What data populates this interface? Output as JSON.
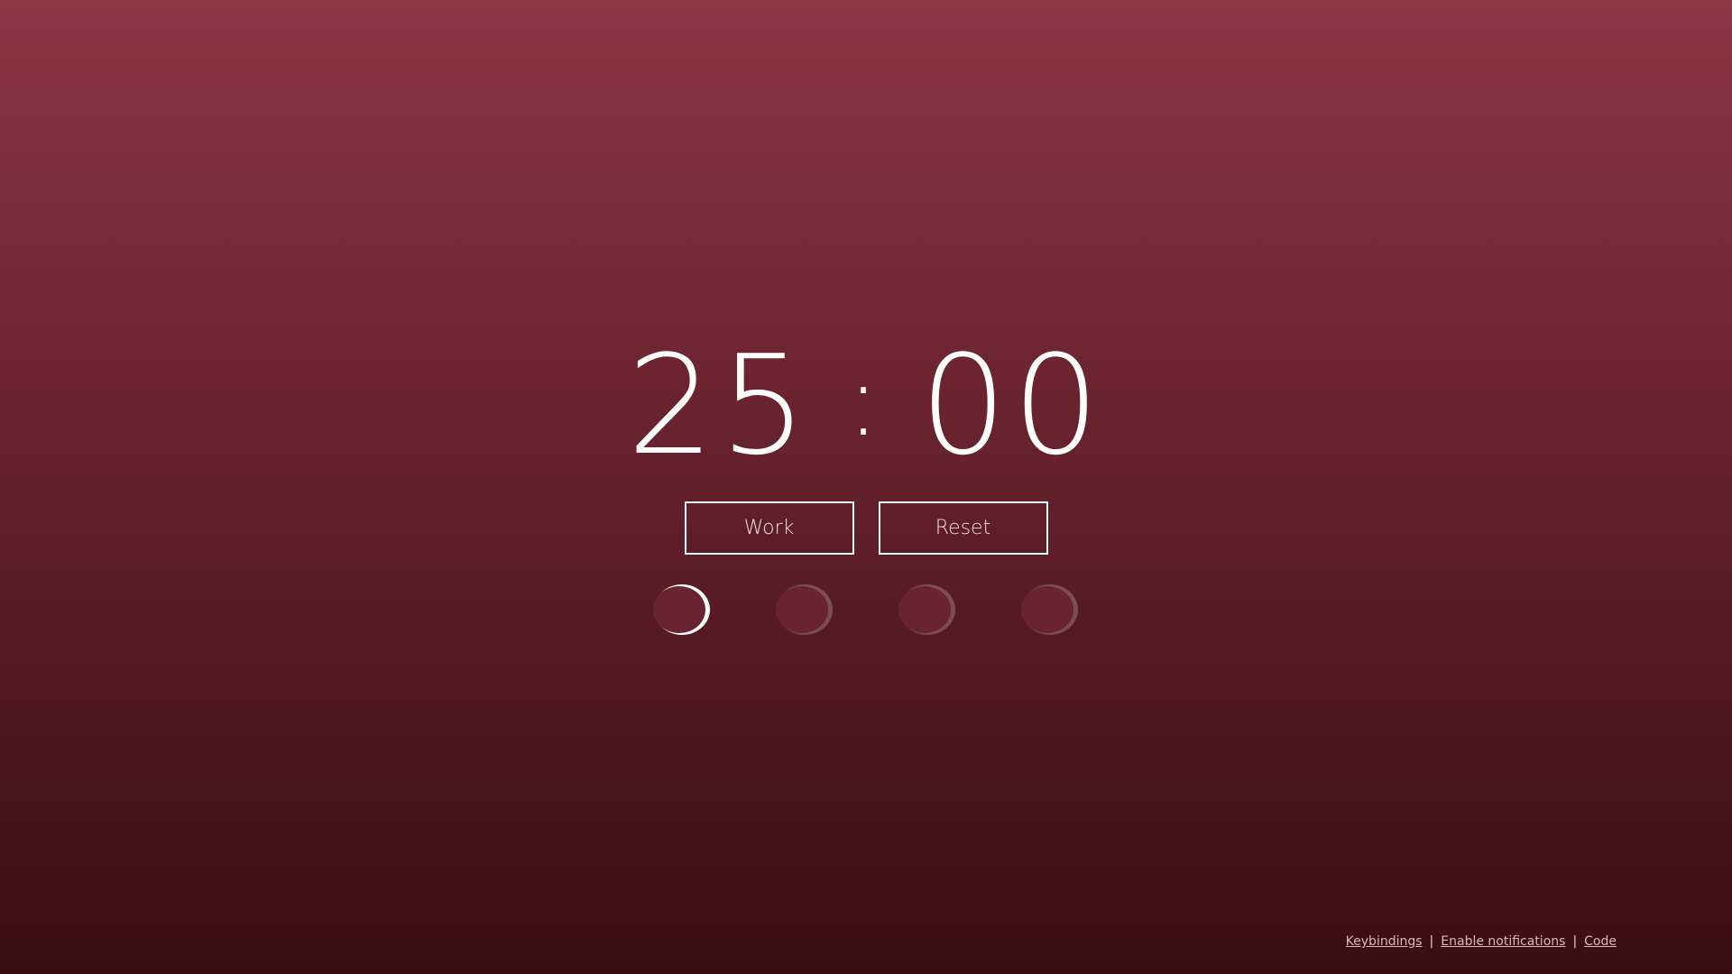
{
  "timer": {
    "minutes": "25",
    "separator": ":",
    "seconds": "00"
  },
  "buttons": {
    "mode_label": "Work",
    "reset_label": "Reset"
  },
  "sessions": {
    "total": 4,
    "active_index": 0,
    "icon": "crescent-moon-icon"
  },
  "footer": {
    "links": [
      "Keybindings",
      "Enable notifications",
      "Code"
    ],
    "separator": "|"
  },
  "colors": {
    "background_top": "#8c3646",
    "background_bottom": "#380d15",
    "foreground": "#ffffff"
  }
}
